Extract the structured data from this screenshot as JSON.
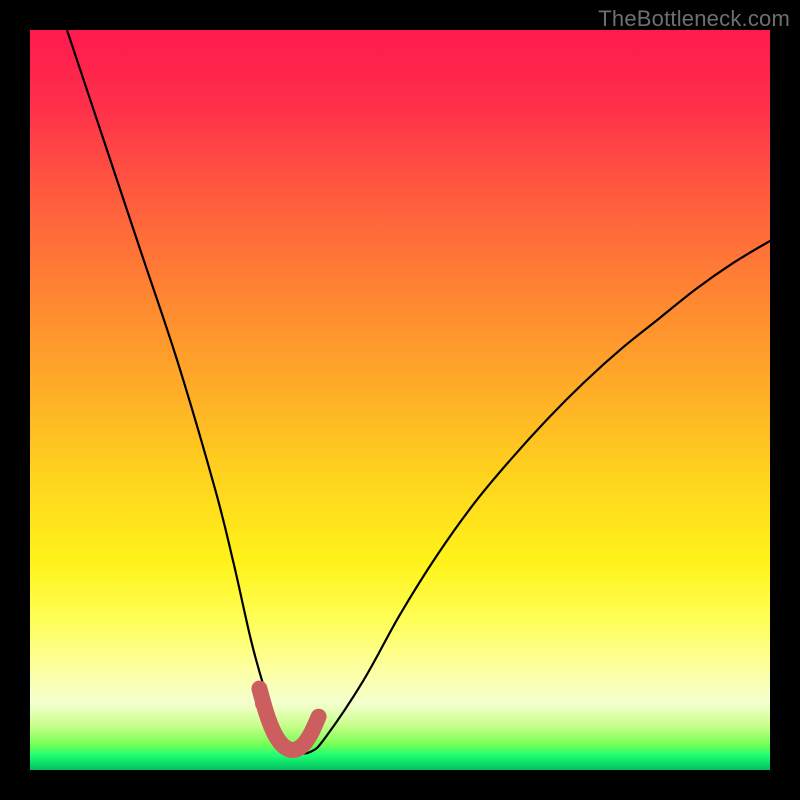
{
  "watermark": "TheBottleneck.com",
  "chart_data": {
    "type": "line",
    "title": "",
    "xlabel": "",
    "ylabel": "",
    "xlim": [
      0,
      100
    ],
    "ylim": [
      0,
      100
    ],
    "grid": false,
    "legend": false,
    "series": [
      {
        "name": "bottleneck-curve",
        "stroke": "#000000",
        "x": [
          5,
          10,
          15,
          20,
          25,
          27.5,
          30,
          32,
          34,
          36,
          38,
          40,
          45,
          50,
          55,
          60,
          65,
          70,
          75,
          80,
          85,
          90,
          95,
          100
        ],
        "values": [
          100,
          85,
          70,
          55,
          38,
          28,
          17,
          10,
          4.5,
          2.5,
          2.5,
          4.5,
          12,
          21,
          29,
          36,
          42,
          47.5,
          52.5,
          57,
          61,
          65,
          68.5,
          71.5
        ]
      },
      {
        "name": "highlight-segment",
        "stroke": "#cc5e60",
        "x": [
          31,
          32,
          33,
          34,
          35,
          36,
          37,
          38,
          39
        ],
        "values": [
          11,
          7.5,
          5,
          3.5,
          2.8,
          2.8,
          3.5,
          5,
          7.2
        ]
      }
    ],
    "points": [
      {
        "name": "highlight-start-dot",
        "x": 31.5,
        "y": 9,
        "r_percent": 1.1,
        "fill": "#cc5e60"
      }
    ]
  }
}
